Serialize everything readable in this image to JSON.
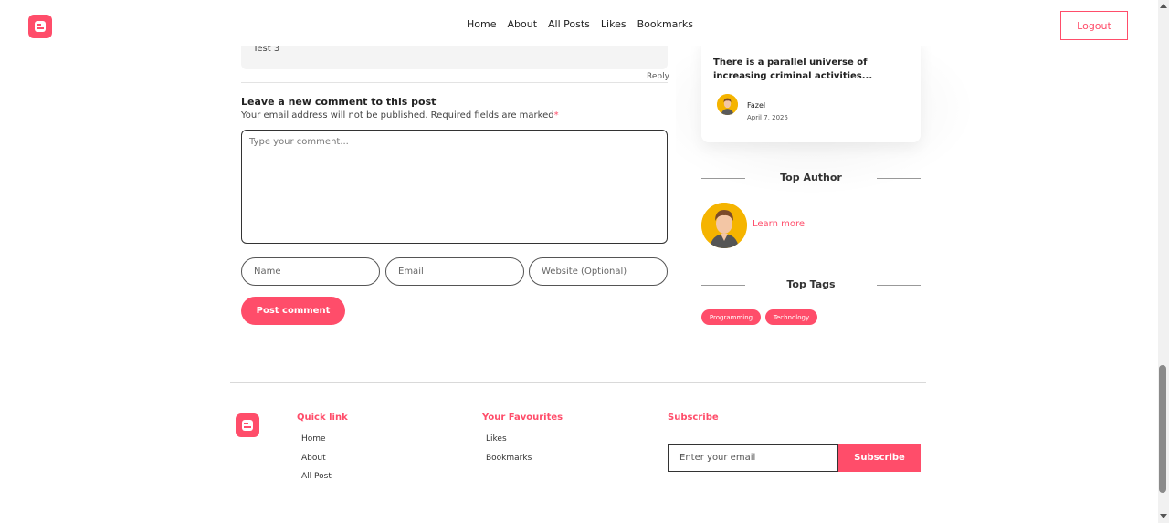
{
  "header": {
    "nav": [
      "Home",
      "About",
      "All Posts",
      "Likes",
      "Bookmarks"
    ],
    "logout_label": "Logout"
  },
  "comments": {
    "previous_text": "Test 3",
    "reply_label": "Reply",
    "form_title": "Leave a new comment to this post",
    "form_subtitle": "Your email address will not be published. Required fields are marked",
    "required_marker": "*",
    "comment_placeholder": "Type your comment...",
    "name_placeholder": "Name",
    "email_placeholder": "Email",
    "website_placeholder": "Website (Optional)",
    "submit_label": "Post comment"
  },
  "sidebar": {
    "recent_post": {
      "title": "There is a parallel universe of increasing criminal activities...",
      "author": "Fazel",
      "date": "April 7, 2025"
    },
    "top_author_title": "Top Author",
    "learn_more_label": "Learn more",
    "top_tags_title": "Top Tags",
    "tags": [
      "Programming",
      "Technology"
    ]
  },
  "footer": {
    "quick_link_title": "Quick link",
    "quick_links": [
      "Home",
      "About",
      "All Post"
    ],
    "favourites_title": "Your Favourites",
    "favourites": [
      "Likes",
      "Bookmarks"
    ],
    "subscribe_title": "Subscribe",
    "subscribe_placeholder": "Enter your email",
    "subscribe_label": "Subscribe"
  },
  "colors": {
    "accent": "#ff4d6a",
    "avatar_bg": "#f5b400"
  },
  "icons": {
    "logo": "blogger-logo-icon",
    "avatar": "user-avatar-icon"
  }
}
